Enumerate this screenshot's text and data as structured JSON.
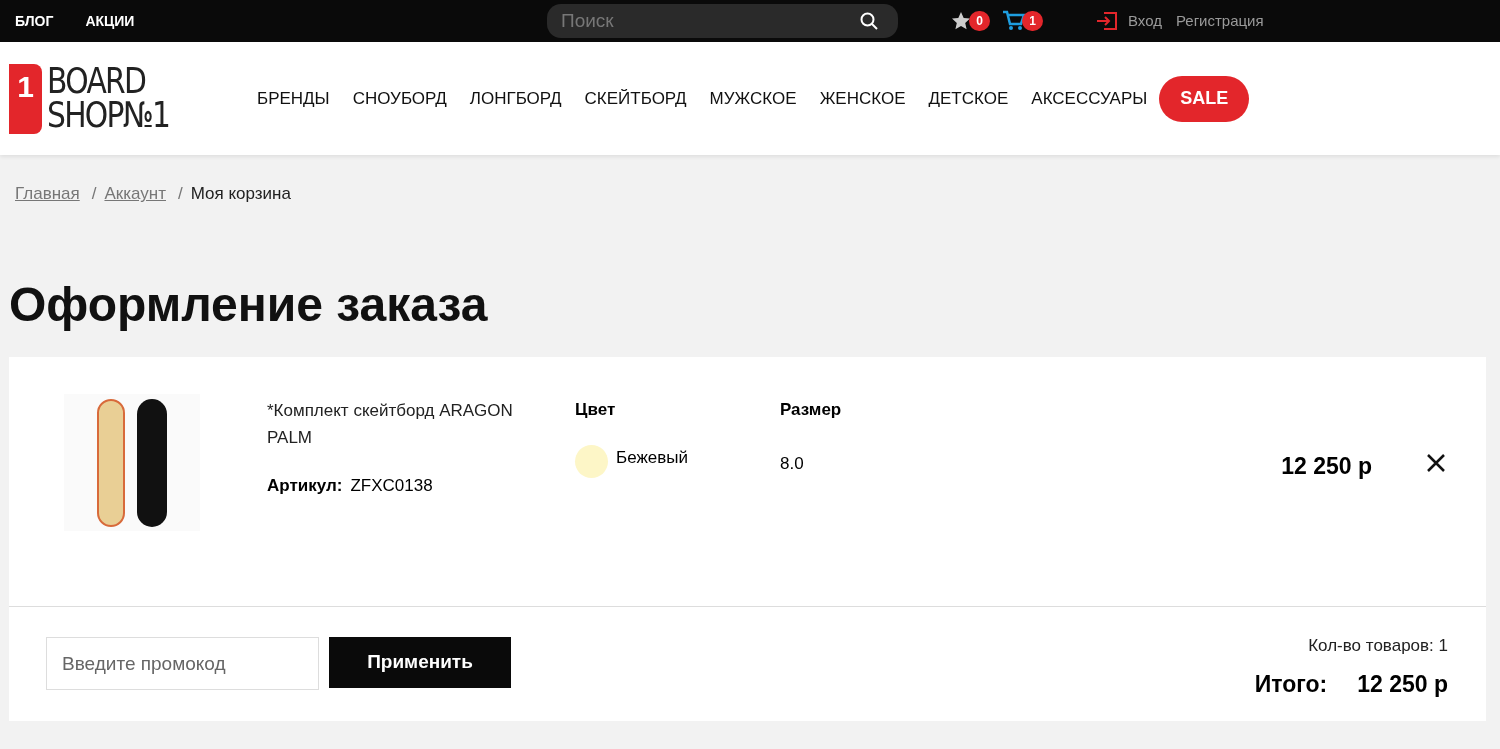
{
  "top_bar": {
    "links": [
      "БЛОГ",
      "АКЦИИ"
    ],
    "search": {
      "placeholder": "Поиск"
    },
    "favorites_count": "0",
    "cart_count": "1",
    "login": "Вход",
    "register": "Регистрация"
  },
  "logo": {
    "mark": "1",
    "line_1": "BOARD",
    "line_2": "SHOP№1"
  },
  "nav": [
    {
      "label": "БРЕНДЫ",
      "kind": "link"
    },
    {
      "label": "СНОУБОРД",
      "kind": "link"
    },
    {
      "label": "ЛОНГБОРД",
      "kind": "link"
    },
    {
      "label": "СКЕЙТБОРД",
      "kind": "link"
    },
    {
      "label": "МУЖСКОЕ",
      "kind": "link"
    },
    {
      "label": "ЖЕНСКОЕ",
      "kind": "link"
    },
    {
      "label": "ДЕТСКОЕ",
      "kind": "link"
    },
    {
      "label": "АКСЕССУАРЫ",
      "kind": "link"
    },
    {
      "label": "SALE",
      "kind": "sale"
    }
  ],
  "breadcrumbs": [
    {
      "label": "Главная",
      "link": true
    },
    {
      "separator": "/",
      "label": "Аккаунт",
      "link": true
    },
    {
      "separator": "/",
      "label": "Моя корзина",
      "link": false
    }
  ],
  "title": "Оформление заказа",
  "cart_items": [
    {
      "name": "*Комплект скейтборд ARAGON PALM",
      "sku_label": "Артикул:",
      "sku": "ZFXC0138",
      "color_heading": "Цвет",
      "color_name": "Бежевый",
      "color": "#fdf6c7",
      "size_heading": "Размер",
      "size": "8.0",
      "price": "12 250 р"
    }
  ],
  "promo": {
    "placeholder": "Введите промокод",
    "button": "Применить"
  },
  "summary": {
    "count": "Кол-во товаров: 1",
    "total_label": "Итого:",
    "total": "12 250 р"
  }
}
